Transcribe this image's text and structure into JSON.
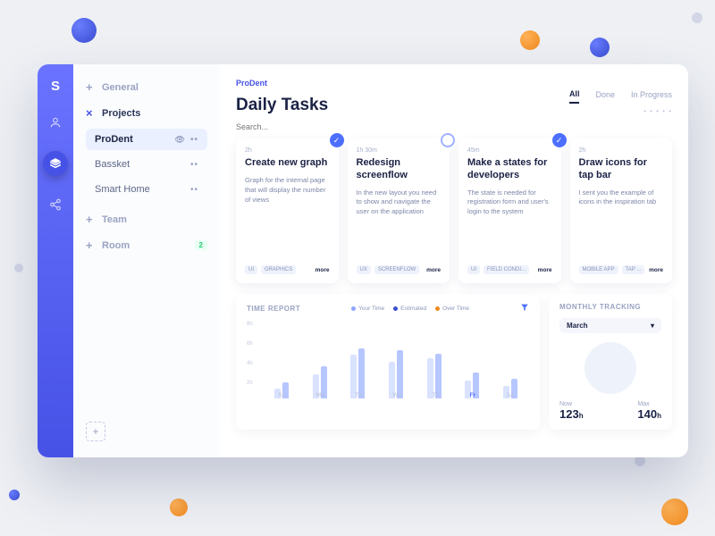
{
  "sidebar": {
    "groups": [
      {
        "label": "General",
        "open": false
      },
      {
        "label": "Projects",
        "open": true,
        "items": [
          {
            "label": "ProDent",
            "selected": true
          },
          {
            "label": "Bassket"
          },
          {
            "label": "Smart Home"
          }
        ]
      },
      {
        "label": "Team",
        "open": false
      },
      {
        "label": "Room",
        "open": false,
        "badge": "2"
      }
    ]
  },
  "header": {
    "breadcrumb": "ProDent",
    "title": "Daily Tasks",
    "search_placeholder": "Search...",
    "tabs": [
      {
        "label": "All",
        "active": true
      },
      {
        "label": "Done"
      },
      {
        "label": "In Progress"
      }
    ]
  },
  "cards": [
    {
      "duration": "2h",
      "title": "Create new graph",
      "desc": "Graph for the internal page that will display the number of views",
      "tags": [
        "UI",
        "GRAPHICS"
      ],
      "more": "more",
      "status": "done"
    },
    {
      "duration": "1h 30m",
      "title": "Redesign screenflow",
      "desc": "In the new layout you need to show and navigate the user on the application",
      "tags": [
        "UX",
        "SCREENFLOW"
      ],
      "more": "more",
      "status": "open"
    },
    {
      "duration": "45m",
      "title": "Make a states for developers",
      "desc": "The state is needed for registration form and user's login to the system",
      "tags": [
        "UI",
        "FIELD CONDI..."
      ],
      "more": "more",
      "status": "done"
    },
    {
      "duration": "2h",
      "title": "Draw icons for tap bar",
      "desc": "I sent you the example of icons in the inspiration tab",
      "tags": [
        "MOBILE APP",
        "TAP ..."
      ],
      "more": "more",
      "status": "none"
    }
  ],
  "time_report": {
    "title": "TIME REPORT",
    "legend": [
      {
        "label": "Your Time",
        "color": "#8fa6ff"
      },
      {
        "label": "Estimated",
        "color": "#3a4dd0"
      },
      {
        "label": "Over Time",
        "color": "#f08a1f"
      }
    ]
  },
  "chart_data": {
    "type": "bar",
    "title": "TIME REPORT",
    "ylabel": "",
    "xlabel": "",
    "ylim": [
      0,
      8
    ],
    "yticks": [
      "8h",
      "6h",
      "4h",
      "2h"
    ],
    "categories": [
      "Su",
      "Mo",
      "Tu",
      "We",
      "Th",
      "Fr",
      "Sa"
    ],
    "series": [
      {
        "name": "Your Time",
        "values": [
          1.2,
          3.0,
          5.4,
          4.6,
          5.0,
          2.2,
          1.6
        ]
      },
      {
        "name": "Estimated",
        "values": [
          2.0,
          4.0,
          6.2,
          6.0,
          5.6,
          3.2,
          2.4
        ]
      }
    ],
    "highlight": "Fr"
  },
  "monthly": {
    "title": "MONTHLY TRACKING",
    "month": "March",
    "now_label": "Now",
    "now_value": "123",
    "now_unit": "h",
    "max_label": "Max",
    "max_value": "140",
    "max_unit": "h"
  }
}
